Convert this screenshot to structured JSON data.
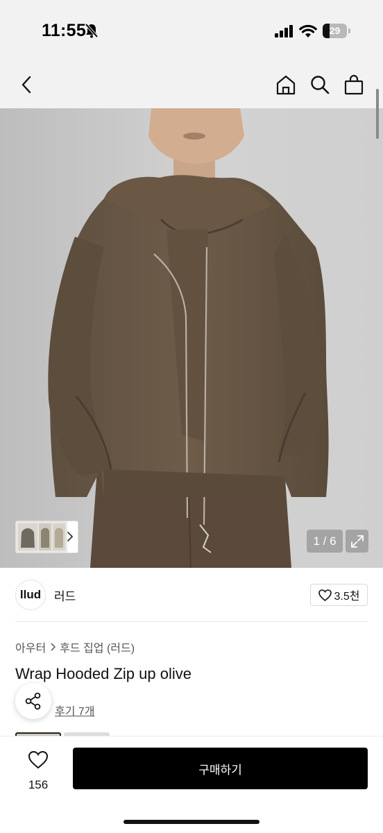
{
  "status_bar": {
    "time": "11:55",
    "battery_level": "29",
    "battery_fraction": 0.29,
    "icons": [
      "bell-slash-icon",
      "cellular-signal-icon",
      "wifi-icon",
      "battery-icon"
    ]
  },
  "nav": {
    "icons": [
      "chevron-left-icon",
      "home-icon",
      "search-icon",
      "shopping-bag-icon"
    ]
  },
  "gallery": {
    "counter": "1 / 6",
    "icons": [
      "chevron-right-icon",
      "expand-icon"
    ]
  },
  "brand": {
    "logo_text": "llud",
    "name": "러드",
    "likes": "3.5천"
  },
  "breadcrumb": {
    "category": "아우터",
    "subcategory": "후드 집업 (러드)"
  },
  "product": {
    "title": "Wrap Hooded Zip up olive",
    "reviews": "후기 7개"
  },
  "bottom_bar": {
    "wishlist_count": "156",
    "buy_label": "구매하기"
  },
  "colors": {
    "accent": "#000000",
    "jacket": "#6b5a47",
    "wall": "#cbcbcb"
  }
}
